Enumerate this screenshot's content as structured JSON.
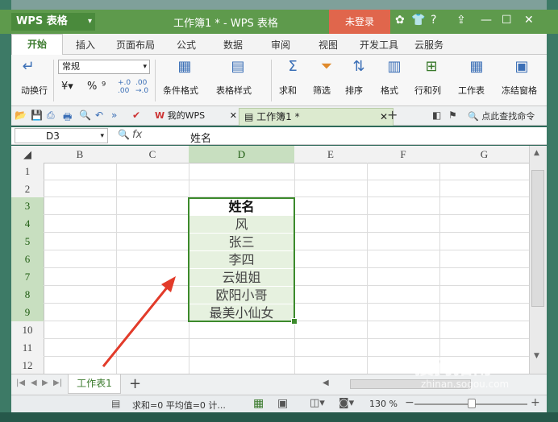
{
  "window": {
    "app_name": "WPS 表格",
    "doc_title": "工作簿1 * - WPS 表格",
    "login_label": "未登录",
    "help_label": "?"
  },
  "ribbon_tabs": [
    "开始",
    "插入",
    "页面布局",
    "公式",
    "数据",
    "审阅",
    "视图",
    "开发工具",
    "云服务"
  ],
  "ribbon": {
    "wrap_label": "动换行",
    "number_format": "常规",
    "percent": "%",
    "comma": "⁹",
    "cond_format": "条件格式",
    "table_style": "表格样式",
    "sum": "求和",
    "filter": "筛选",
    "sort": "排序",
    "format": "格式",
    "row_col": "行和列",
    "worksheet": "工作表",
    "freeze": "冻结窗格"
  },
  "doc_tabs": {
    "my_wps": "我的WPS",
    "workbook": "工作簿1 *",
    "find_command": "点此查找命令"
  },
  "formula_bar": {
    "cell_ref": "D3",
    "fx": "fx",
    "value": "姓名"
  },
  "columns": [
    "B",
    "C",
    "D",
    "E",
    "F",
    "G"
  ],
  "rows": [
    "1",
    "2",
    "3",
    "4",
    "5",
    "6",
    "7",
    "8",
    "9",
    "10",
    "11",
    "12"
  ],
  "cells": {
    "D3": "姓名",
    "D4": "风",
    "D5": "张三",
    "D6": "李四",
    "D7": "云姐姐",
    "D8": "欧阳小哥",
    "D9": "最美小仙女"
  },
  "sheet": {
    "tab_name": "工作表1",
    "add_label": "+"
  },
  "status": {
    "text": "求和=0  平均值=0  计...",
    "zoom": "130 %"
  },
  "watermark": {
    "text": "搜狗指南",
    "url": "zhinan.sogou.com"
  },
  "colors": {
    "accent": "#5e9a4c",
    "login": "#e0664c",
    "selection": "#3c8a2c"
  }
}
